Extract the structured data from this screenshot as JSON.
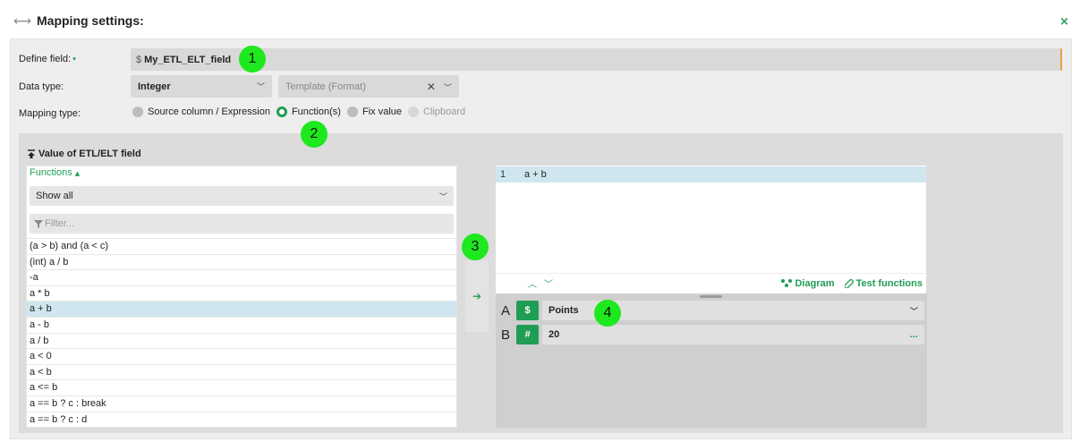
{
  "header": {
    "title": "Mapping settings:",
    "move_icon": "double-arrow-icon",
    "close_symbol": "×"
  },
  "form": {
    "define_label": "Define field:",
    "define_required": "•",
    "define_prefix": "$",
    "define_value": "My_ETL_ELT_field",
    "datatype_label": "Data type:",
    "datatype_value": "Integer",
    "template_placeholder": "Template (Format)",
    "mapping_label": "Mapping type:",
    "mapping_options": [
      "Source column / Expression",
      "Function(s)",
      "Fix value",
      "Clipboard"
    ],
    "mapping_selected": "Function(s)"
  },
  "section": {
    "title": "Value of ETL/ELT field",
    "functions_label": "Functions",
    "showall_value": "Show all",
    "filter_placeholder": "Filter...",
    "functions": [
      "(a > b) and (a < c)",
      "(int) a / b",
      "-a",
      "a * b",
      "a + b",
      "a - b",
      "a / b",
      "a < 0",
      "a < b",
      "a <= b",
      "a == b ? c : break",
      "a == b ? c : d"
    ],
    "selected_function": "a + b",
    "transfer_icon": "arrow-right-icon"
  },
  "editor": {
    "line_number": "1",
    "line_text": "a + b",
    "diagram_label": "Diagram",
    "test_label": "Test functions"
  },
  "args": [
    {
      "name": "A",
      "type": "$",
      "value": "Points",
      "control": "dropdown"
    },
    {
      "name": "B",
      "type": "#",
      "value": "20",
      "control": "more",
      "more_symbol": "..."
    }
  ],
  "badges": [
    "1",
    "2",
    "3",
    "4"
  ],
  "colors": {
    "accent": "#1f9d55",
    "badge": "#1ee81e",
    "selection": "#cfe6ef"
  }
}
